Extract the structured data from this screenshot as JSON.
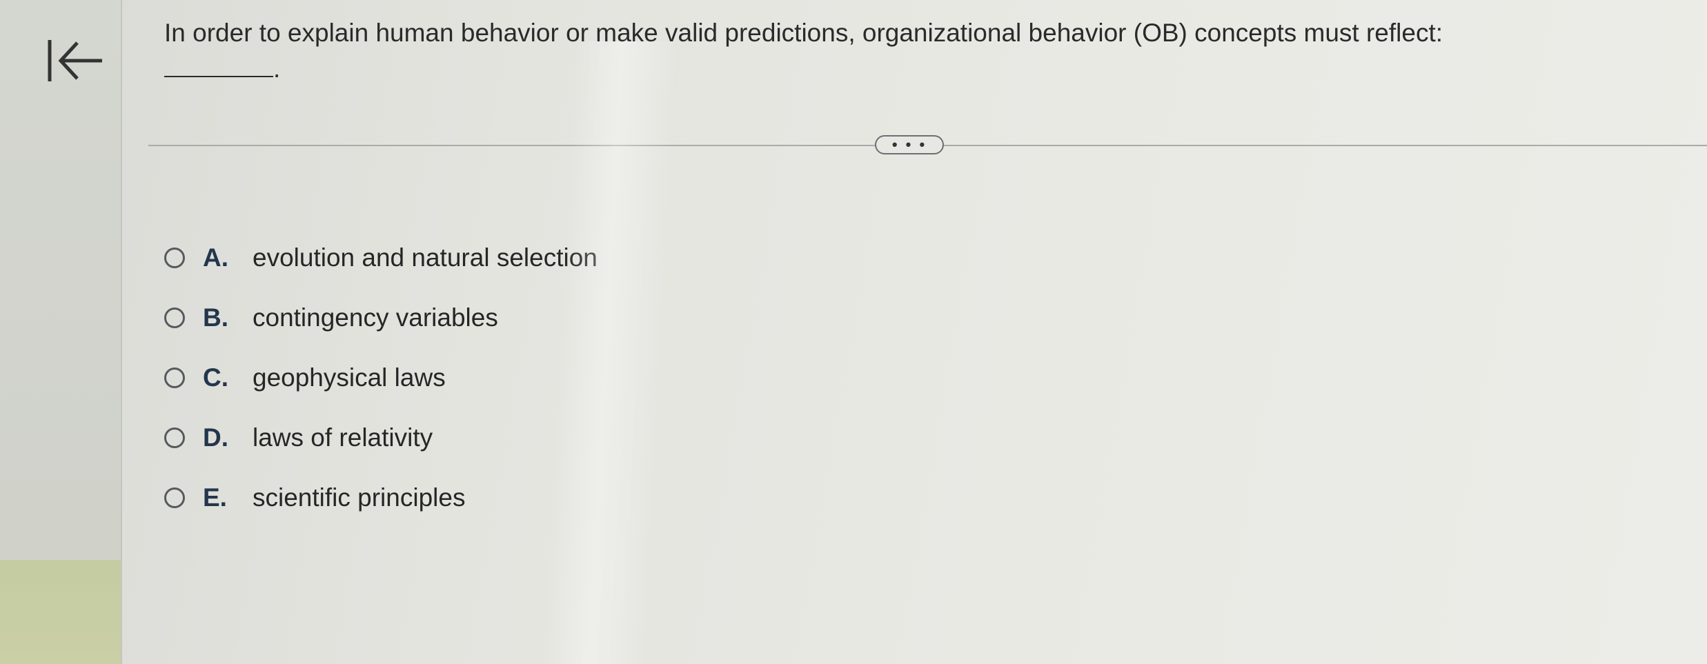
{
  "question": {
    "text": "In order to explain human behavior or make valid predictions, organizational behavior (OB) concepts must reflect:",
    "suffix": "."
  },
  "toolbar": {
    "back_icon": "first-page-arrow-icon",
    "more_label": "• • •"
  },
  "options": [
    {
      "letter": "A.",
      "text": "evolution and natural selection"
    },
    {
      "letter": "B.",
      "text": "contingency variables"
    },
    {
      "letter": "C.",
      "text": "geophysical laws"
    },
    {
      "letter": "D.",
      "text": "laws of relativity"
    },
    {
      "letter": "E.",
      "text": "scientific principles"
    }
  ],
  "colors": {
    "option_letter": "#23364c",
    "text": "#262626",
    "divider": "#a7aca8"
  }
}
